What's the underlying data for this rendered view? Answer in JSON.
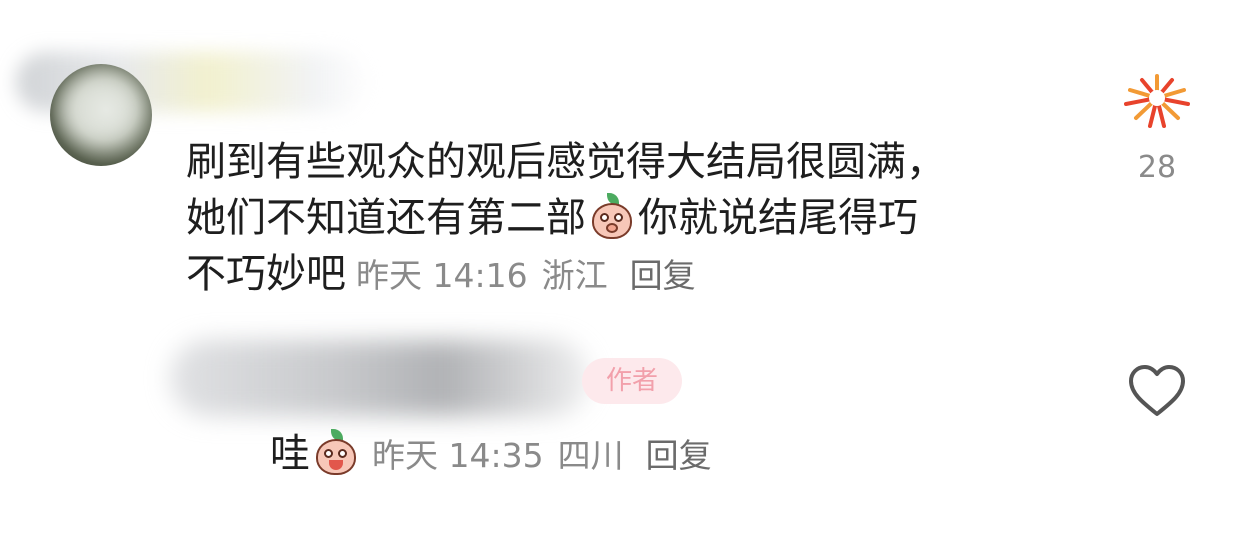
{
  "comment": {
    "line1": "刷到有些观众的观后感觉得大结局很圆满，",
    "line2_a": "她们不知道还有第二部",
    "line2_b": "你就说结尾得巧",
    "line3": "不巧妙吧",
    "time": "昨天 14:16",
    "location": "浙江",
    "reply_label": "回复",
    "emoji_icon": "peach-covering-mouth-emoji-icon",
    "like_icon": "firework-icon",
    "like_count": "28"
  },
  "reply": {
    "author_badge": "作者",
    "text": "哇",
    "emoji_icon": "peach-surprised-emoji-icon",
    "time": "昨天 14:35",
    "location": "四川",
    "reply_label": "回复",
    "like_icon": "heart-outline-icon"
  },
  "colors": {
    "text": "#1e1e1e",
    "meta": "#8a8a8a",
    "badge_bg": "#fde9ec",
    "badge_text": "#f2a0ab",
    "firework_red": "#e8432c",
    "firework_orange": "#f29a35"
  }
}
